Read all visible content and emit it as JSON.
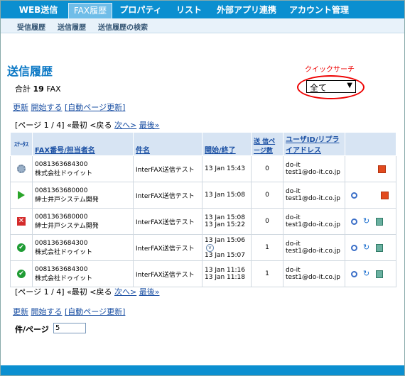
{
  "nav": {
    "tabs": [
      {
        "label": "WEB送信"
      },
      {
        "label": "FAX履歴"
      },
      {
        "label": "プロパティ"
      },
      {
        "label": "リスト"
      },
      {
        "label": "外部アプリ連携"
      },
      {
        "label": "アカウント管理"
      }
    ]
  },
  "subnav": [
    "受信履歴",
    "送信履歴",
    "送信履歴の検索"
  ],
  "page_title": "送信履歴",
  "total": {
    "prefix": "合計",
    "count": "19",
    "suffix": "FAX"
  },
  "quick_search": {
    "label": "クイックサーチ",
    "selected": "全て",
    "arrow": "▼"
  },
  "actions": {
    "refresh": "更新",
    "start": "開始する",
    "auto_refresh": "[自動ページ更新]"
  },
  "pager": {
    "pages": "[ページ 1 / 4]",
    "first": "«最初",
    "prev": "<戻る",
    "next": "次へ>",
    "last": "最後»"
  },
  "table": {
    "headers": {
      "status": "ｽﾃｰﾀｽ",
      "fax": "FAX番号/担当者名",
      "subject": "件名",
      "startend": "開始/終了",
      "pages": "送 信ページ数",
      "user": "ユーザID/リプライアドレス"
    },
    "rows": [
      {
        "status_icon": "gear-icon",
        "fax": "0081363684300",
        "name": "株式会社ドゥイット",
        "subject": "InterFAX送信テスト",
        "start": "13 Jan 15:43",
        "end": "",
        "pages": "0",
        "user": "do-it",
        "email": "test1@do-it.co.jp",
        "actions": [
          "cancel-icon"
        ]
      },
      {
        "status_icon": "play-icon",
        "fax": "0081363680000",
        "name": "紳士井戸システム開発",
        "subject": "InterFAX送信テスト",
        "start": "13 Jan 15:08",
        "end": "",
        "pages": "0",
        "user": "do-it",
        "email": "test1@do-it.co.jp",
        "actions": [
          "view-icon",
          "cancel-icon"
        ]
      },
      {
        "status_icon": "error-icon",
        "fax": "0081363680000",
        "name": "紳士井戸システム開発",
        "subject": "InterFAX送信テスト",
        "start": "13 Jan 15:08",
        "end": "13 Jan 15:22",
        "pages": "0",
        "user": "do-it",
        "email": "test1@do-it.co.jp",
        "actions": [
          "view-icon",
          "resend-icon",
          "delete-icon"
        ]
      },
      {
        "status_icon": "success-icon",
        "fax": "0081363684300",
        "name": "株式会社ドゥイット",
        "subject": "InterFAX送信テスト",
        "start": "13 Jan 15:06",
        "end": "13 Jan 15:07",
        "pages": "1",
        "user": "do-it",
        "email": "test1@do-it.co.jp",
        "actions": [
          "view-icon",
          "resend-icon",
          "delete-icon"
        ]
      },
      {
        "status_icon": "success-icon",
        "fax": "0081363684300",
        "name": "株式会社ドゥイット",
        "subject": "InterFAX送信テスト",
        "start": "13 Jan 11:16",
        "end": "13 Jan 11:18",
        "pages": "1",
        "user": "do-it",
        "email": "test1@do-it.co.jp",
        "actions": [
          "view-icon",
          "resend-icon",
          "delete-icon"
        ]
      }
    ]
  },
  "per_page": {
    "label": "件/ページ",
    "value": "5"
  },
  "colors": {
    "nav": "#0b8fd0",
    "title": "#0b78c5",
    "header_bg": "#d7e4f3",
    "highlight": "#e00"
  }
}
